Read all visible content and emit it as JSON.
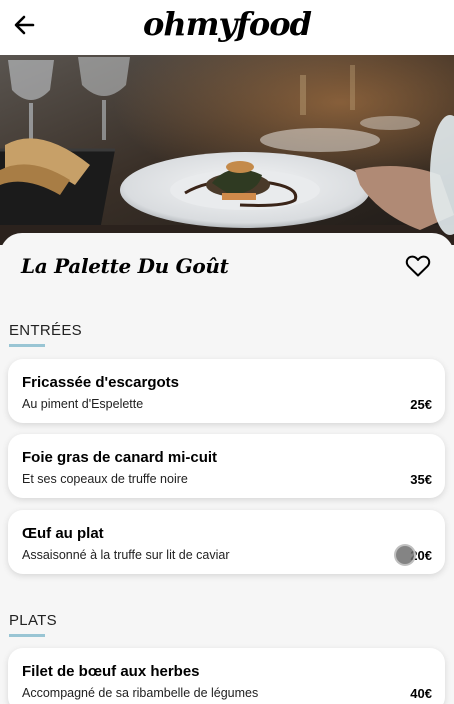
{
  "app": {
    "logo": "ohmyfood",
    "back_icon": "arrow-left-icon"
  },
  "restaurant": {
    "name": "La Palette Du Goût",
    "favorite_icon": "heart-outline-icon"
  },
  "sections": [
    {
      "title": "ENTRÉES",
      "dishes": [
        {
          "name": "Fricassée d'escargots",
          "description": "Au piment d'Espelette",
          "price": "25€"
        },
        {
          "name": "Foie gras de canard mi-cuit",
          "description": "Et ses copeaux de truffe noire",
          "price": "35€"
        },
        {
          "name": "Œuf au plat",
          "description": "Assaisonné à la truffe sur lit de caviar",
          "price": "20€"
        }
      ]
    },
    {
      "title": "PLATS",
      "dishes": [
        {
          "name": "Filet de bœuf aux herbes",
          "description": "Accompagné de sa ribambelle de légumes",
          "price": "40€"
        }
      ]
    }
  ],
  "colors": {
    "accent": "#99c5d4",
    "background": "#f6f6f6",
    "card": "#ffffff"
  }
}
